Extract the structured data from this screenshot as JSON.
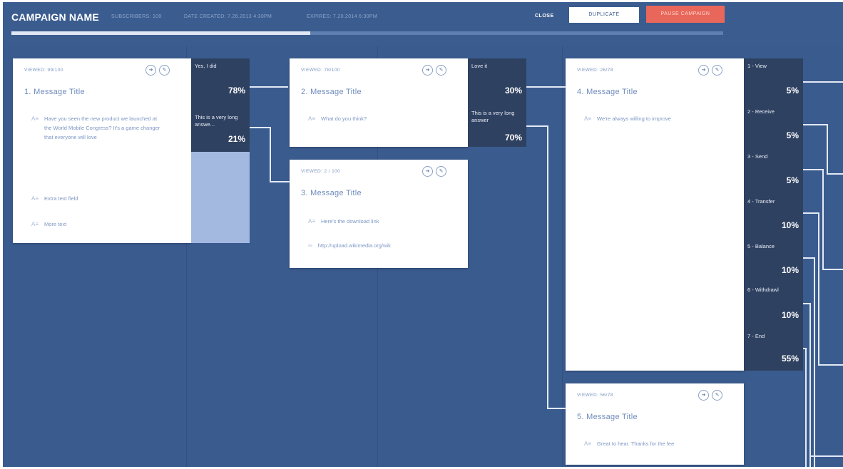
{
  "header": {
    "campaign_name": "CAMPAIGN NAME",
    "subscribers": "SUBSCRIBERS: 100",
    "date_created": "DATE CREATED: 7.26.2013 4:30PM",
    "expires": "EXPIRES: 7.20.2014 6:30PM",
    "close_label": "CLOSE",
    "duplicate_label": "DUPLICATE",
    "pause_label": "PAUSE CAMPAIGN",
    "progress": 0.42
  },
  "cards": [
    {
      "viewed": "VIEWED: 99/100",
      "title": "1. Message Title",
      "fields": [
        {
          "icon": "A≡",
          "text": "Have you seen the new product we launched at the World Mobile Congress? It's a game changer that everyone will love"
        },
        {
          "icon": "A≡",
          "text": "Extra text field"
        },
        {
          "icon": "A≡",
          "text": "More text"
        }
      ],
      "icon_share": "➔",
      "icon_edit": "✎"
    },
    {
      "viewed": "VIEWED: 78/100",
      "title": "2. Message Title",
      "fields": [
        {
          "icon": "A≡",
          "text": "What do you think?"
        }
      ],
      "icon_share": "➔",
      "icon_edit": "✎"
    },
    {
      "viewed": "VIEWED: 2 / 100",
      "title": "3. Message Title",
      "fields": [
        {
          "icon": "A≡",
          "text": "Here's the download link"
        },
        {
          "icon": "∞",
          "text": "http://upload.wikimedia.org/wik"
        }
      ],
      "icon_share": "➔",
      "icon_edit": "✎"
    },
    {
      "viewed": "VIEWED: 26/78",
      "title": "4. Message Title",
      "fields": [
        {
          "icon": "A≡",
          "text": "We're always willing to improve"
        }
      ],
      "icon_share": "➔",
      "icon_edit": "✎"
    },
    {
      "viewed": "VIEWED: 56/78",
      "title": "5. Message Title",
      "fields": [
        {
          "icon": "A≡",
          "text": "Great to hear. Thanks for the fee"
        }
      ],
      "icon_share": "➔",
      "icon_edit": "✎"
    }
  ],
  "responses_1": [
    {
      "label": "Yes, I did",
      "value": "78%"
    },
    {
      "label": "This is a very long answe...",
      "value": "21%"
    }
  ],
  "responses_2": [
    {
      "label": "Love it",
      "value": "30%"
    },
    {
      "label": "This is a very long answer",
      "value": "70%"
    }
  ],
  "responses_4": [
    {
      "label": "1 - View",
      "value": "5%"
    },
    {
      "label": "2 - Receive",
      "value": "5%"
    },
    {
      "label": "3 - Send",
      "value": "5%"
    },
    {
      "label": "4 - Transfer",
      "value": "10%"
    },
    {
      "label": "5 - Balance",
      "value": "10%"
    },
    {
      "label": "6 - Withdrawl",
      "value": "10%"
    },
    {
      "label": "7 - End",
      "value": "55%"
    }
  ],
  "colors": {
    "background": "#3a5b8e",
    "card": "#ffffff",
    "response_panel": "#2f4161",
    "accent_fill": "#a3b9e0",
    "pause_button": "#e8675a"
  }
}
